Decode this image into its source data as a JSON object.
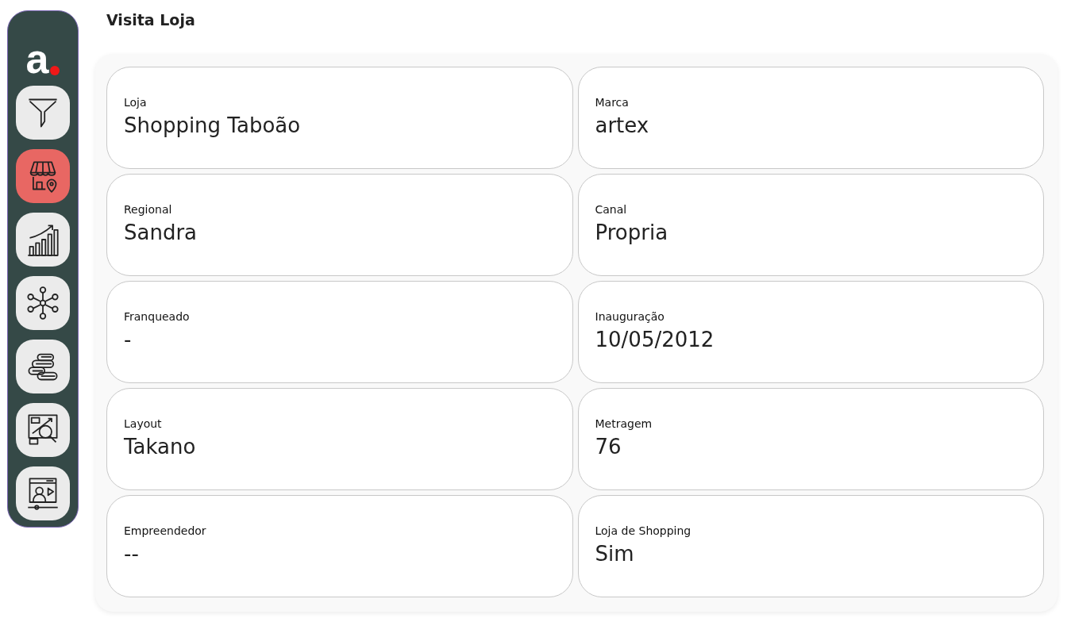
{
  "sidebar": {
    "logo": "a",
    "items": [
      {
        "selected": false
      },
      {
        "selected": true
      },
      {
        "selected": false
      },
      {
        "selected": false
      },
      {
        "selected": false
      },
      {
        "selected": false
      },
      {
        "selected": false
      }
    ]
  },
  "title": "Visita Loja",
  "fields": [
    {
      "label": "Loja",
      "value": "Shopping Taboão"
    },
    {
      "label": "Marca",
      "value": "artex"
    },
    {
      "label": "Regional",
      "value": "Sandra"
    },
    {
      "label": "Canal",
      "value": "Propria"
    },
    {
      "label": "Franqueado",
      "value": "-"
    },
    {
      "label": "Inauguração",
      "value": "10/05/2012"
    },
    {
      "label": "Layout",
      "value": "Takano"
    },
    {
      "label": "Metragem",
      "value": "76"
    },
    {
      "label": "Empreendedor",
      "value": "--"
    },
    {
      "label": "Loja de Shopping",
      "value": "Sim"
    }
  ]
}
